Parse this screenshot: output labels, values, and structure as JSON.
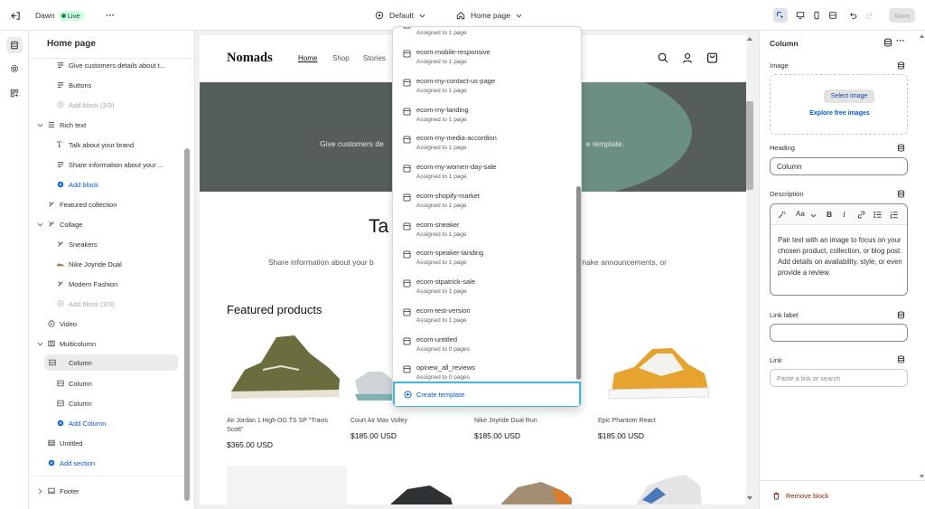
{
  "topbar": {
    "theme_name": "Dawn",
    "live_label": "Live",
    "more_label": "···",
    "theme_selector": "Default",
    "page_selector": "Home page",
    "save_label": "Save"
  },
  "sidebar": {
    "title": "Home page",
    "rows": [
      {
        "label": "Give customers details about t...",
        "style": "normal"
      },
      {
        "label": "Buttons",
        "style": "normal"
      },
      {
        "label": "Add block (3/3)",
        "style": "muted"
      },
      {
        "label": "Rich text",
        "style": "normal"
      },
      {
        "label": "Talk about your brand",
        "style": "normal"
      },
      {
        "label": "Share information about your ...",
        "style": "normal"
      },
      {
        "label": "Add block",
        "style": "link"
      },
      {
        "label": "Featured collection",
        "style": "normal"
      },
      {
        "label": "Collage",
        "style": "normal"
      },
      {
        "label": "Sneakers",
        "style": "normal"
      },
      {
        "label": "Nike Joyride Dual",
        "style": "normal"
      },
      {
        "label": "Modern Fashion",
        "style": "normal"
      },
      {
        "label": "Add block (3/3)",
        "style": "muted"
      },
      {
        "label": "Video",
        "style": "normal"
      },
      {
        "label": "Multicolumn",
        "style": "normal"
      },
      {
        "label": "Column",
        "style": "selected"
      },
      {
        "label": "Column",
        "style": "normal"
      },
      {
        "label": "Column",
        "style": "normal"
      },
      {
        "label": "Add Column",
        "style": "link"
      },
      {
        "label": "Untitled",
        "style": "normal"
      },
      {
        "label": "Add section",
        "style": "link"
      },
      {
        "label": "Footer",
        "style": "normal"
      }
    ]
  },
  "preview": {
    "logo": "Nomads",
    "nav": [
      "Home",
      "Shop",
      "Stories"
    ],
    "hero_text_left": "Give customers de",
    "hero_text_right": "e template.",
    "heading": "Ta",
    "sub_left": "Share information about your b",
    "sub_right": "make announcements, or",
    "featured_title": "Featured products",
    "products": [
      {
        "name": "Air Jordan 1 High OG TS SP \"Travis Scott\"",
        "price": "$365.00 USD"
      },
      {
        "name": "Court Air Max Volley",
        "price": "$185.00 USD"
      },
      {
        "name": "Nike Joyride Dual Run",
        "price": "$185.00 USD"
      },
      {
        "name": "Epic Phantom React",
        "price": "$185.00 USD"
      }
    ]
  },
  "dropdown": {
    "items": [
      {
        "name": "",
        "assigned": "Assigned to 1 page"
      },
      {
        "name": "ecom-mobile-responsive",
        "assigned": "Assigned to 1 page"
      },
      {
        "name": "ecom-my-contact-us-page",
        "assigned": "Assigned to 1 page"
      },
      {
        "name": "ecom-my-landing",
        "assigned": "Assigned to 1 page"
      },
      {
        "name": "ecom-my-media-accordion",
        "assigned": "Assigned to 1 page"
      },
      {
        "name": "ecom-my-women-day-sale",
        "assigned": "Assigned to 1 page"
      },
      {
        "name": "ecom-shopify-market",
        "assigned": "Assigned to 1 page"
      },
      {
        "name": "ecom-sneaker",
        "assigned": "Assigned to 1 page"
      },
      {
        "name": "ecom-speaker-landing",
        "assigned": "Assigned to 1 page"
      },
      {
        "name": "ecom-stpatrick-sale",
        "assigned": "Assigned to 1 page"
      },
      {
        "name": "ecom-test-version",
        "assigned": "Assigned to 1 page"
      },
      {
        "name": "ecom-untitled",
        "assigned": "Assigned to 0 pages"
      },
      {
        "name": "opinew_all_reviews",
        "assigned": "Assigned to 0 pages"
      }
    ],
    "create_label": "Create template"
  },
  "inspector": {
    "title": "Column",
    "image_label": "Image",
    "select_image": "Select image",
    "explore_images": "Explore free images",
    "heading_label": "Heading",
    "heading_value": "Column",
    "description_label": "Description",
    "description_text": "Pair text with an image to focus on your chosen product, collection, or blog post. Add details on availability, style, or even provide a review.",
    "link_label_label": "Link label",
    "link_label_value": "",
    "link_label": "Link",
    "link_placeholder": "Paste a link or search",
    "remove_label": "Remove block"
  },
  "colors": {
    "accent": "#005bd3",
    "highlight": "#3eb8d6",
    "danger": "#8e1f0b",
    "live_bg": "#cdfee1"
  }
}
